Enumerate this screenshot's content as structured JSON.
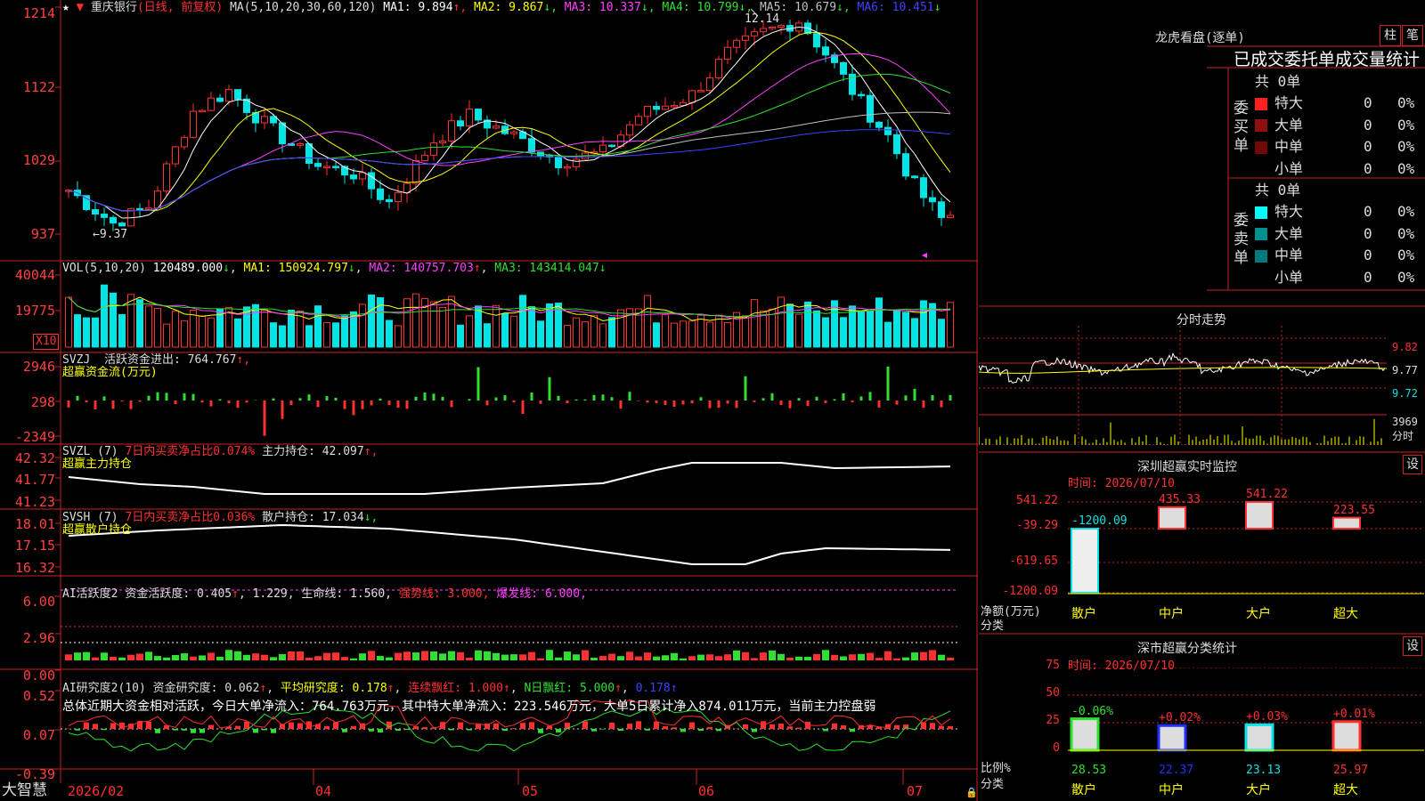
{
  "colors": {
    "up": "#ff3030",
    "down": "#00e5e5",
    "ma1": "#ffffff",
    "ma2": "#ffff00",
    "ma3": "#ff40ff",
    "ma4": "#30e030",
    "ma5": "#c0c0c0",
    "ma6": "#4040ff",
    "grid": "#cc2222",
    "bg": "#000000"
  },
  "main": {
    "title": "重庆银行",
    "mode": "(日线, 前复权)",
    "ma_label": "MA(5,10,20,30,60,120)",
    "ma_values": [
      {
        "k": "MA1:",
        "v": "9.894",
        "a": "↑",
        "c": "#ffffff"
      },
      {
        "k": "MA2:",
        "v": "9.867",
        "a": "↓",
        "c": "#ffff00"
      },
      {
        "k": "MA3:",
        "v": "10.337",
        "a": "↓",
        "c": "#ff40ff"
      },
      {
        "k": "MA4:",
        "v": "10.799",
        "a": "↓",
        "c": "#30e030"
      },
      {
        "k": "MA5:",
        "v": "10.679",
        "a": "↓",
        "c": "#c0c0c0"
      },
      {
        "k": "MA6:",
        "v": "10.451",
        "a": "↓",
        "c": "#4040ff"
      }
    ],
    "yticks": [
      "1214",
      "1122",
      "1029",
      "937"
    ],
    "high_label": "12.14",
    "low_label": "←9.37"
  },
  "vol": {
    "hdr": "VOL(5,10,20)",
    "val": "120489.000",
    "a": "↓",
    "ma1": "MA1: 150924.797",
    "ma1a": "↓",
    "ma2": "MA2: 140757.703",
    "ma2a": "↑",
    "ma3": "MA3: 143414.047",
    "ma3a": "↓",
    "yticks": [
      "40044",
      "19775"
    ],
    "unit": "X10"
  },
  "svzj": {
    "hdr": "SVZJ",
    "label": "活跃资金进出: 764.767",
    "a": "↑,",
    "sub": "超赢资金流(万元)",
    "yticks": [
      "2946",
      "298",
      "-2349"
    ]
  },
  "svzl": {
    "hdr": "SVZL (7)",
    "label1": "7日内买卖净占比0.074%",
    "label2": "主力持仓: 42.097",
    "a": "↑,",
    "sub": "超赢主力持仓",
    "yticks": [
      "42.32",
      "41.77",
      "41.23"
    ]
  },
  "svsh": {
    "hdr": "SVSH (7)",
    "label1": "7日内买卖净占比0.036%",
    "label2": "散户持仓: 17.034",
    "a": "↓,",
    "sub": "超赢散户持仓",
    "yticks": [
      "18.01",
      "17.15",
      "16.32"
    ]
  },
  "ai1": {
    "hdr": "AI活跃度2",
    "label": "资金活跃度: 0.405",
    "v2": "1.229,",
    "life": "生命线: 1.560,",
    "strong": "强势线: 3.000,",
    "burst": "爆发线: 6.000,",
    "yticks": [
      "6.00",
      "2.96",
      "0.00"
    ]
  },
  "ai2": {
    "hdr": "AI研究度2(10)",
    "label": "资金研究度: 0.062",
    "avg": "平均研究度: 0.178",
    "cont": "连续飘红: 1.000",
    "n": "N日飘红: 5.000",
    "last": "0.178",
    "comment": "总体近期大资金相对活跃，今日大单净流入：764.763万元，其中特大单净流入：223.546万元，大单5日累计净入874.011万元，当前主力控盘弱",
    "yticks": [
      "0.52",
      "0.07",
      "-0.39"
    ]
  },
  "xaxis": {
    "logo": "大智慧",
    "labels": [
      "2026/02",
      "04",
      "05",
      "06",
      "07"
    ]
  },
  "lhb": {
    "title": "龙虎看盘(逐单)",
    "btn1": "柱",
    "btn2": "笔",
    "head": "已成交委托单成交量统计",
    "buy_label": "委买单",
    "sell_label": "委卖单",
    "buy_total": "共 0单",
    "sell_total": "共 0单",
    "buy": [
      {
        "n": "特大",
        "v": "0",
        "p": "0%",
        "c": "#ff2020"
      },
      {
        "n": "大单",
        "v": "0",
        "p": "0%",
        "c": "#901010"
      },
      {
        "n": "中单",
        "v": "0",
        "p": "0%",
        "c": "#700808"
      },
      {
        "n": "小单",
        "v": "0",
        "p": "0%",
        "c": "#000000"
      }
    ],
    "sell": [
      {
        "n": "特大",
        "v": "0",
        "p": "0%",
        "c": "#00ffff"
      },
      {
        "n": "大单",
        "v": "0",
        "p": "0%",
        "c": "#009090"
      },
      {
        "n": "中单",
        "v": "0",
        "p": "0%",
        "c": "#007a7a"
      },
      {
        "n": "小单",
        "v": "0",
        "p": "0%",
        "c": "#000000"
      }
    ]
  },
  "fst": {
    "title": "分时走势",
    "y1": "9.82",
    "y2": "9.77",
    "y3": "9.72",
    "vol": "3969",
    "unit": "分时"
  },
  "mon": {
    "title": "深圳超赢实时监控",
    "btn": "设",
    "time": "时间: 2026/07/10",
    "yticks": [
      "541.22",
      "-39.29",
      "-619.65",
      "-1200.09"
    ],
    "axis": "净额(万元)",
    "cat": "分类",
    "bars": [
      {
        "n": "散户",
        "v": "-1200.09"
      },
      {
        "n": "中户",
        "v": "435.33"
      },
      {
        "n": "大户",
        "v": "541.22"
      },
      {
        "n": "超大",
        "v": "223.55"
      }
    ]
  },
  "cls": {
    "title": "深市超赢分类统计",
    "btn": "设",
    "time": "时间: 2026/07/10",
    "yticks": [
      "75",
      "50",
      "25",
      "0"
    ],
    "axis": "比例%",
    "cat": "分类",
    "bars": [
      {
        "n": "散户",
        "v": "28.53",
        "d": "-0.06%"
      },
      {
        "n": "中户",
        "v": "22.37",
        "d": "+0.02%"
      },
      {
        "n": "大户",
        "v": "23.13",
        "d": "+0.03%"
      },
      {
        "n": "超大",
        "v": "25.97",
        "d": "+0.01%"
      }
    ]
  },
  "chart_data": {
    "type": "candlestick",
    "title": "重庆银行",
    "ylim": [
      9.37,
      12.14
    ],
    "x_labels": [
      "2026/02",
      "04",
      "05",
      "06",
      "07"
    ],
    "high": 12.14,
    "low": 9.37
  }
}
